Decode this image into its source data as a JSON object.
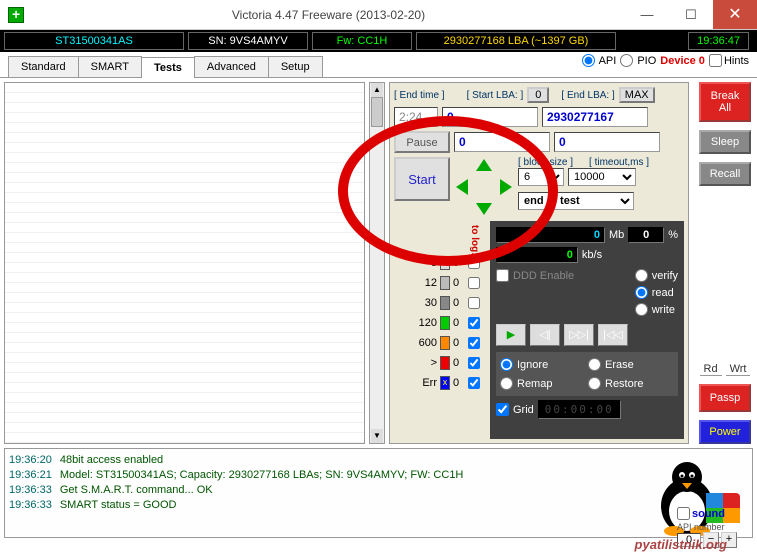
{
  "window": {
    "title": "Victoria 4.47  Freeware (2013-02-20)"
  },
  "info": {
    "model": "ST31500341AS",
    "sn": "SN: 9VS4AMYV",
    "fw": "Fw: CC1H",
    "lba": "2930277168 LBA (~1397 GB)",
    "time": "19:36:47"
  },
  "tabs": {
    "standard": "Standard",
    "smart": "SMART",
    "tests": "Tests",
    "advanced": "Advanced",
    "setup": "Setup"
  },
  "api": {
    "api_label": "API",
    "pio_label": "PIO",
    "device": "Device 0",
    "hints": "Hints"
  },
  "ctrl": {
    "end_time_lbl": "[ End time ]",
    "start_lba_lbl": "[ Start LBA: ]",
    "start_lba_btn": "0",
    "end_lba_lbl": "[ End LBA: ]",
    "max_btn": "MAX",
    "end_time_val": "2:24",
    "start_lba_val": "0",
    "end_lba_val": "2930277167",
    "pause": "Pause",
    "mid_val": "0",
    "right_val": "0",
    "start": "Start",
    "block_size_lbl": "[ block size ]",
    "block_size_val": "6",
    "timeout_lbl": "[ timeout,ms ]",
    "timeout_val": "10000",
    "end_of_test": "end of test"
  },
  "legend": {
    "r1": {
      "lbl": "3",
      "cnt": "0"
    },
    "r2": {
      "lbl": "12",
      "cnt": "0"
    },
    "r3": {
      "lbl": "30",
      "cnt": "0"
    },
    "r4": {
      "lbl": "120",
      "cnt": "0"
    },
    "r5": {
      "lbl": "600",
      "cnt": "0"
    },
    "r6": {
      "lbl": ">",
      "cnt": "0"
    },
    "r7": {
      "lbl": "Err",
      "cnt": "0"
    },
    "tolog": "to log:"
  },
  "meters": {
    "mb": "0",
    "mb_unit": "Mb",
    "pct": "0",
    "pct_unit": "%",
    "kbs": "0",
    "kbs_unit": "kb/s",
    "ddd": "DDD Enable",
    "verify": "verify",
    "read": "read",
    "write": "write",
    "ignore": "Ignore",
    "erase": "Erase",
    "remap": "Remap",
    "restore": "Restore",
    "grid": "Grid",
    "timer": "00:00:00"
  },
  "side": {
    "break": "Break All",
    "sleep": "Sleep",
    "recall": "Recall",
    "rd": "Rd",
    "wrt": "Wrt",
    "passp": "Passp",
    "power": "Power"
  },
  "bottom": {
    "sound": "sound",
    "api_num_lbl": "API number",
    "api_num": "0"
  },
  "log": [
    {
      "ts": "19:36:20",
      "msg": "48bit access enabled"
    },
    {
      "ts": "19:36:21",
      "msg": "Model: ST31500341AS; Capacity: 2930277168 LBAs; SN: 9VS4AMYV; FW: CC1H"
    },
    {
      "ts": "19:36:33",
      "msg": "Get S.M.A.R.T. command... OK"
    },
    {
      "ts": "19:36:33",
      "msg": "SMART status = GOOD"
    }
  ],
  "watermark": "pyatilistnik.org"
}
